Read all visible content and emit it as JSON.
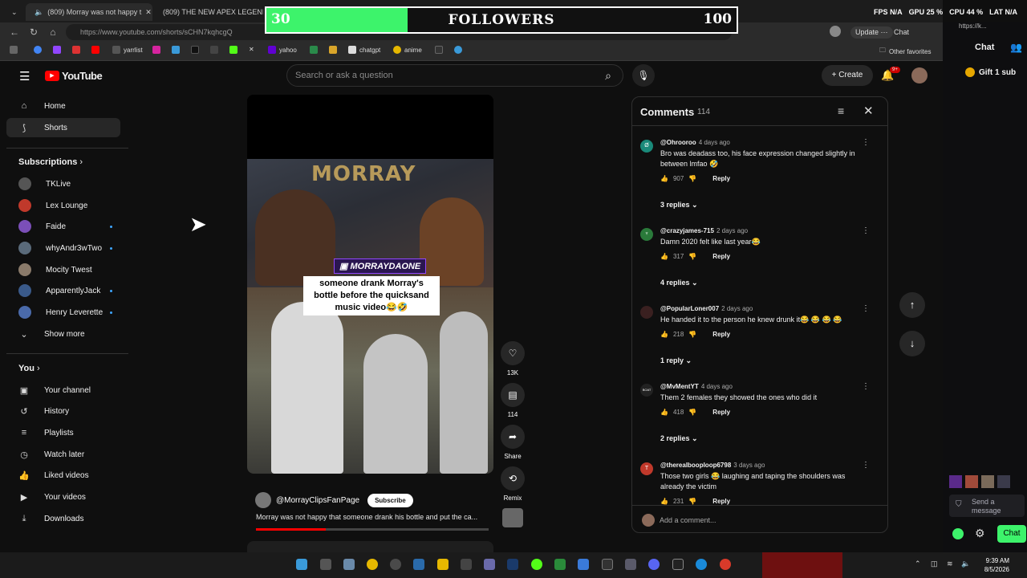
{
  "browser": {
    "tabs": [
      {
        "title": "(809) Morray was not happy t"
      },
      {
        "title": "(809) THE NEW APEX LEGENDS S"
      }
    ],
    "url": "https://www.youtube.com/shorts/sCHN7kqhcgQ",
    "update_label": "Update",
    "chat_label": "Chat",
    "other_favorites": "Other favorites",
    "bookmarks": [
      "yarrlist",
      "yahoo",
      "chatgpt",
      "anime"
    ]
  },
  "overlay": {
    "current": "30",
    "label": "FOLLOWERS",
    "goal": "100",
    "progress_fraction": 0.3
  },
  "stats": {
    "fps_label": "FPS",
    "fps_value": "N/A",
    "gpu_label": "GPU",
    "gpu_value": "25 %",
    "cpu_label": "CPU",
    "cpu_value": "44 %",
    "lat_label": "LAT",
    "lat_value": "N/A"
  },
  "youtube": {
    "logo": "YouTube",
    "search_placeholder": "Search or ask a question",
    "create_label": "Create",
    "notif_badge": "9+"
  },
  "sidebar": {
    "home": "Home",
    "shorts": "Shorts",
    "subscriptions_heading": "Subscriptions",
    "subscriptions": [
      {
        "name": "TKLive",
        "color": "#555555",
        "live": false
      },
      {
        "name": "Lex Lounge",
        "color": "#c0392b",
        "live": false
      },
      {
        "name": "Faide",
        "color": "#7b4fb8",
        "live": true
      },
      {
        "name": "whyAndr3wTwo",
        "color": "#5a6a7a",
        "live": true
      },
      {
        "name": "Mocity Twest",
        "color": "#8a7a6a",
        "live": false
      },
      {
        "name": "ApparentlyJack",
        "color": "#3a5a8a",
        "live": true
      },
      {
        "name": "Henry Leverette",
        "color": "#4a6aaa",
        "live": true
      }
    ],
    "show_more": "Show more",
    "you_heading": "You",
    "you_items": [
      "Your channel",
      "History",
      "Playlists",
      "Watch later",
      "Liked videos",
      "Your videos",
      "Downloads"
    ]
  },
  "video": {
    "sign_text": "MORRAY",
    "twitch_tag": "MORRAYDAONE",
    "caption": "someone drank Morray's bottle before the quicksand music video😂🤣",
    "channel": "@MorrayClipsFanPage",
    "subscribe": "Subscribe",
    "title": "Morray was not happy that someone drank his bottle and put the ca...",
    "progress_fraction": 0.3
  },
  "actions": {
    "likes": "13K",
    "comments": "114",
    "share": "Share",
    "remix": "Remix"
  },
  "comments": {
    "title": "Comments",
    "count": "114",
    "add_placeholder": "Add a comment...",
    "items": [
      {
        "user": "@Ohrooroo",
        "time": "4 days ago",
        "text": "Bro was deadass too, his face expression changed slightly in between lmfao 🤣",
        "likes": "907",
        "replies": "3 replies",
        "avatar_color": "#1a8a7a",
        "avatar_letter": "Ø"
      },
      {
        "user": "@crazyjames-715",
        "time": "2 days ago",
        "text": "Damn 2020 felt like last year😂",
        "likes": "317",
        "replies": "4 replies",
        "avatar_color": "#2a7a3a",
        "avatar_letter": "♆"
      },
      {
        "user": "@PopularLoner007",
        "time": "2 days ago",
        "text": "He handed it to the person he knew drunk it😂 😂 😂 😂",
        "likes": "218",
        "replies": "1 reply",
        "avatar_color": "#3a2020",
        "avatar_letter": ""
      },
      {
        "user": "@MvMentYT",
        "time": "4 days ago",
        "text": "Them 2 females they showed the ones who did it",
        "likes": "418",
        "replies": "2 replies",
        "avatar_color": "#222222",
        "avatar_letter": "BOAT"
      },
      {
        "user": "@therealbooploop6798",
        "time": "3 days ago",
        "text": "Those two girls 😂 laughing and taping the shoulders was already the victim",
        "likes": "231",
        "replies": "",
        "avatar_color": "#c0392b",
        "avatar_letter": "T"
      }
    ],
    "reply_label": "Reply"
  },
  "chat_panel": {
    "url": "https://k...",
    "title": "Chat",
    "gift": "Gift 1 sub",
    "send_placeholder": "Send a message",
    "chat_button": "Chat"
  },
  "taskbar": {
    "time": "9:39 AM",
    "date": "8/5/2026"
  }
}
